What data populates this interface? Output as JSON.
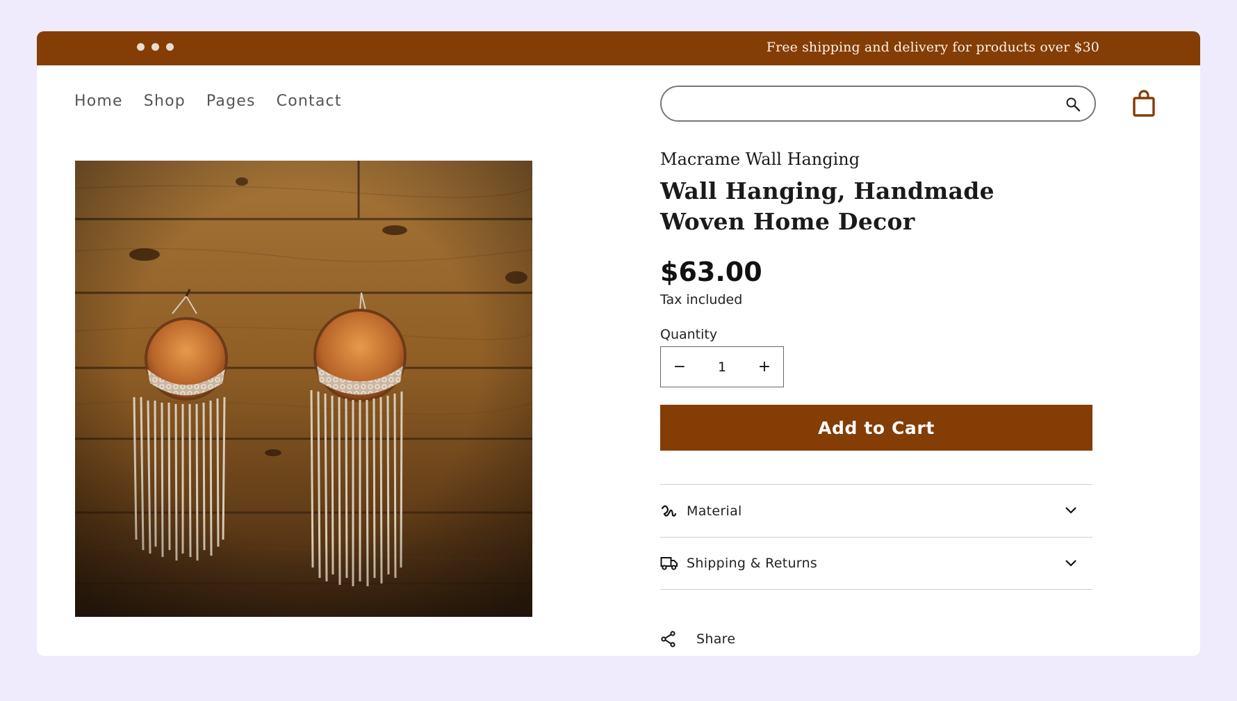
{
  "announcement": {
    "text": "Free shipping and delivery for products over $30"
  },
  "nav": {
    "items": [
      "Home",
      "Shop",
      "Pages",
      "Contact"
    ]
  },
  "search": {
    "value": "",
    "placeholder": ""
  },
  "product": {
    "vendor": "Macrame Wall Hanging",
    "title": "Wall Hanging, Handmade Woven Home Decor",
    "price": "$63.00",
    "tax_note": "Tax included",
    "quantity_label": "Quantity",
    "quantity": "1",
    "decrease_symbol": "−",
    "increase_symbol": "+",
    "add_to_cart_label": "Add to Cart",
    "image_subject": "two macrame wall hangings on wood planks"
  },
  "accordion": [
    {
      "label": "Material",
      "icon": "thread-icon"
    },
    {
      "label": "Shipping & Returns",
      "icon": "truck-icon"
    }
  ],
  "share": {
    "label": "Share",
    "icon": "share-icon"
  },
  "colors": {
    "brand": "#833d05",
    "page_background": "#efeafc",
    "card": "#ffffff"
  },
  "icons": {
    "search": "search-icon",
    "cart": "shopping-bag-icon",
    "chevron": "chevron-down-icon"
  }
}
